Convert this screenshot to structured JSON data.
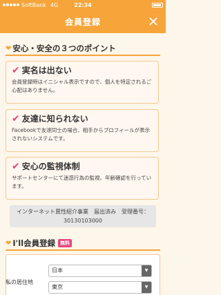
{
  "status_bar": {
    "carrier": "SoftBank",
    "network": "4G",
    "time": "22:34"
  },
  "nav": {
    "title": "会員登録",
    "close_icon": "close-icon"
  },
  "points_section": {
    "title": "安心・安全の３つのポイント"
  },
  "points": [
    {
      "title": "実名は出ない",
      "body": "会員登録時はイニシャル表示ですので、個人を特定されるご心配はありません。"
    },
    {
      "title": "友達に知られない",
      "body": "Facebookで友達同士の場合、相手からプロフィールが表示されないシステムです。"
    },
    {
      "title": "安心の監視体制",
      "body": "サポートセンターにて迷惑行為の監視、年齢確認を行っています。"
    }
  ],
  "license_text": "インターネット異性紹介事業　届出済み　受理番号：30130103000",
  "register_section": {
    "title": "I'll会員登録",
    "badge": "無料"
  },
  "residence": {
    "label": "私の居住地",
    "country": "日本",
    "prefecture": "東京"
  },
  "colors": {
    "accent": "#f6a53a",
    "pink": "#e8457c"
  }
}
